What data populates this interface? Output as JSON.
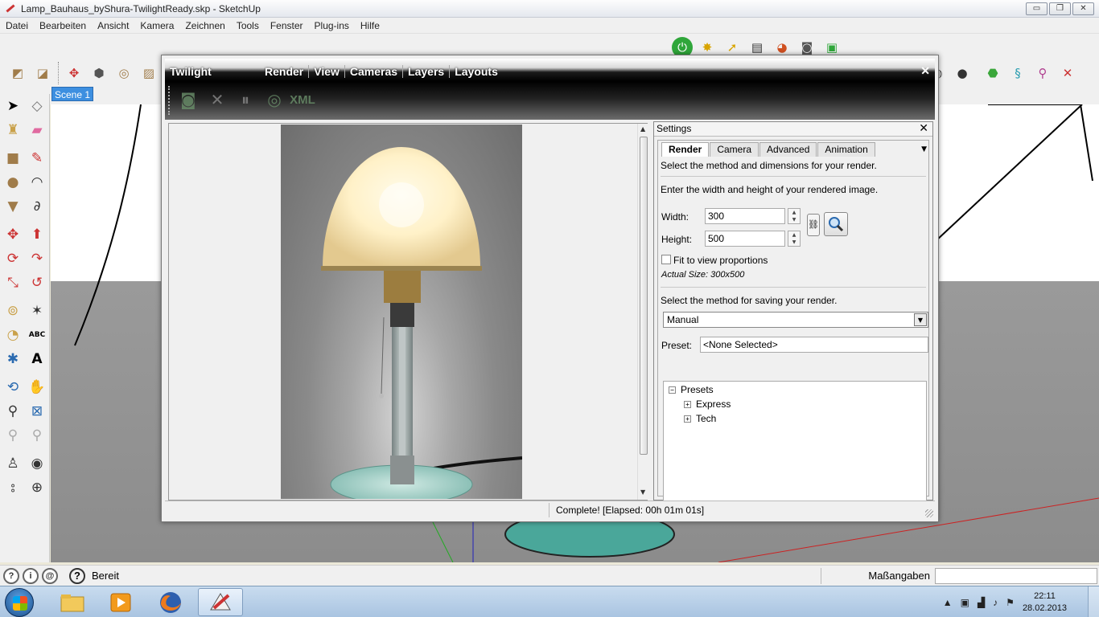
{
  "window": {
    "title": "Lamp_Bauhaus_byShura-TwilightReady.skp - SketchUp",
    "minimize": "▭",
    "restore": "❐",
    "close": "✕"
  },
  "menu": [
    "Datei",
    "Bearbeiten",
    "Ansicht",
    "Kamera",
    "Zeichnen",
    "Tools",
    "Fenster",
    "Plug-ins",
    "Hilfe"
  ],
  "scene_tab": "Scene 1",
  "status": {
    "text": "Bereit",
    "measurements_label": "Maßangaben",
    "help": "?"
  },
  "twilight": {
    "title": "Twilight",
    "menus": [
      "Render",
      "View",
      "Cameras",
      "Layers",
      "Layouts"
    ],
    "close": "✕",
    "toolbar": {
      "xml_label": "XML"
    },
    "status_message": "Complete!  [Elapsed: 00h 01m 01s]"
  },
  "settings": {
    "title": "Settings",
    "close": "✕",
    "tabs": [
      "Render",
      "Camera",
      "Advanced",
      "Animation"
    ],
    "active_tab": "Render",
    "method_text": "Select the method and dimensions for your render.",
    "dims_text": "Enter the width and height of your rendered image.",
    "width_label": "Width:",
    "width_value": "300",
    "height_label": "Height:",
    "height_value": "500",
    "fit_label": "Fit to view proportions",
    "actual_size": "Actual Size: 300x500",
    "save_text": "Select the method for saving your render.",
    "save_method": "Manual",
    "preset_label": "Preset:",
    "preset_value": "<None Selected>",
    "tree": {
      "root": "Presets",
      "children": [
        "Express",
        "Tech"
      ]
    }
  },
  "taskbar": {
    "time": "22:11",
    "date": "28.02.2013"
  }
}
